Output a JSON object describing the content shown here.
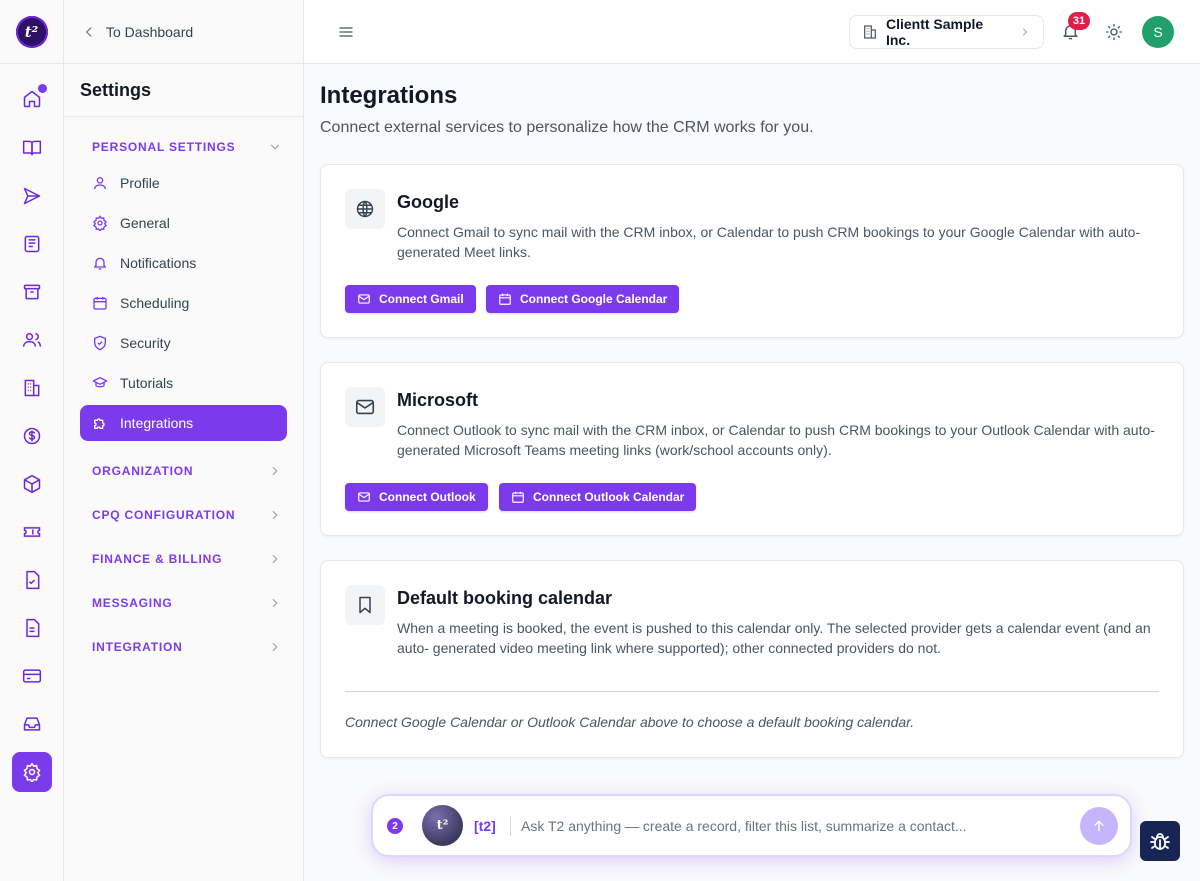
{
  "colors": {
    "accent": "#7c3aed",
    "badge": "#e11d48",
    "avatar": "#22a06b"
  },
  "app": {
    "logo_text": "t²"
  },
  "rail": [
    {
      "icon": "home-icon"
    },
    {
      "icon": "book-icon"
    },
    {
      "icon": "send-icon"
    },
    {
      "icon": "newspaper-icon"
    },
    {
      "icon": "archive-icon"
    },
    {
      "icon": "users-icon"
    },
    {
      "icon": "building-icon"
    },
    {
      "icon": "dollar-icon"
    },
    {
      "icon": "box-icon"
    },
    {
      "icon": "ticket-icon"
    },
    {
      "icon": "file-check-icon"
    },
    {
      "icon": "file-text-icon"
    },
    {
      "icon": "credit-card-icon"
    },
    {
      "icon": "inbox-icon"
    },
    {
      "icon": "settings-icon"
    }
  ],
  "sidebar": {
    "back_label": "To Dashboard",
    "title": "Settings",
    "sections": [
      "PERSONAL SETTINGS",
      "ORGANIZATION",
      "CPQ CONFIGURATION",
      "FINANCE & BILLING",
      "MESSAGING",
      "INTEGRATION"
    ],
    "items": [
      {
        "label": "Profile",
        "icon": "user-icon"
      },
      {
        "label": "General",
        "icon": "gear-icon"
      },
      {
        "label": "Notifications",
        "icon": "bell-icon"
      },
      {
        "label": "Scheduling",
        "icon": "calendar-icon"
      },
      {
        "label": "Security",
        "icon": "shield-icon"
      },
      {
        "label": "Tutorials",
        "icon": "graduation-cap-icon"
      },
      {
        "label": "Integrations",
        "icon": "puzzle-icon"
      }
    ]
  },
  "topbar": {
    "org_name": "Clientt Sample Inc.",
    "notification_count": "31",
    "avatar_initial": "S"
  },
  "main": {
    "title": "Integrations",
    "subtitle": "Connect external services to personalize how the CRM works for you.",
    "google": {
      "title": "Google",
      "description": "Connect Gmail to sync mail with the CRM inbox, or Calendar to push CRM bookings to your Google Calendar with auto-generated Meet links.",
      "buttons": [
        "Connect Gmail",
        "Connect Google Calendar"
      ]
    },
    "microsoft": {
      "title": "Microsoft",
      "description": "Connect Outlook to sync mail with the CRM inbox, or Calendar to push CRM bookings to your Outlook Calendar with auto-generated Microsoft Teams meeting links (work/school accounts only).",
      "buttons": [
        "Connect Outlook",
        "Connect Outlook Calendar"
      ]
    },
    "booking": {
      "title": "Default booking calendar",
      "description": "When a meeting is booked, the event is pushed to this calendar only. The selected provider gets a calendar event (and an auto- generated video meeting link where supported); other connected providers do not.",
      "hint": "Connect Google Calendar or Outlook Calendar above to choose a default booking calendar."
    }
  },
  "assistant": {
    "count": "2",
    "avatar_text": "t²",
    "tag": "[t2]",
    "placeholder": "Ask T2 anything — create a record, filter this list, summarize a contact..."
  }
}
